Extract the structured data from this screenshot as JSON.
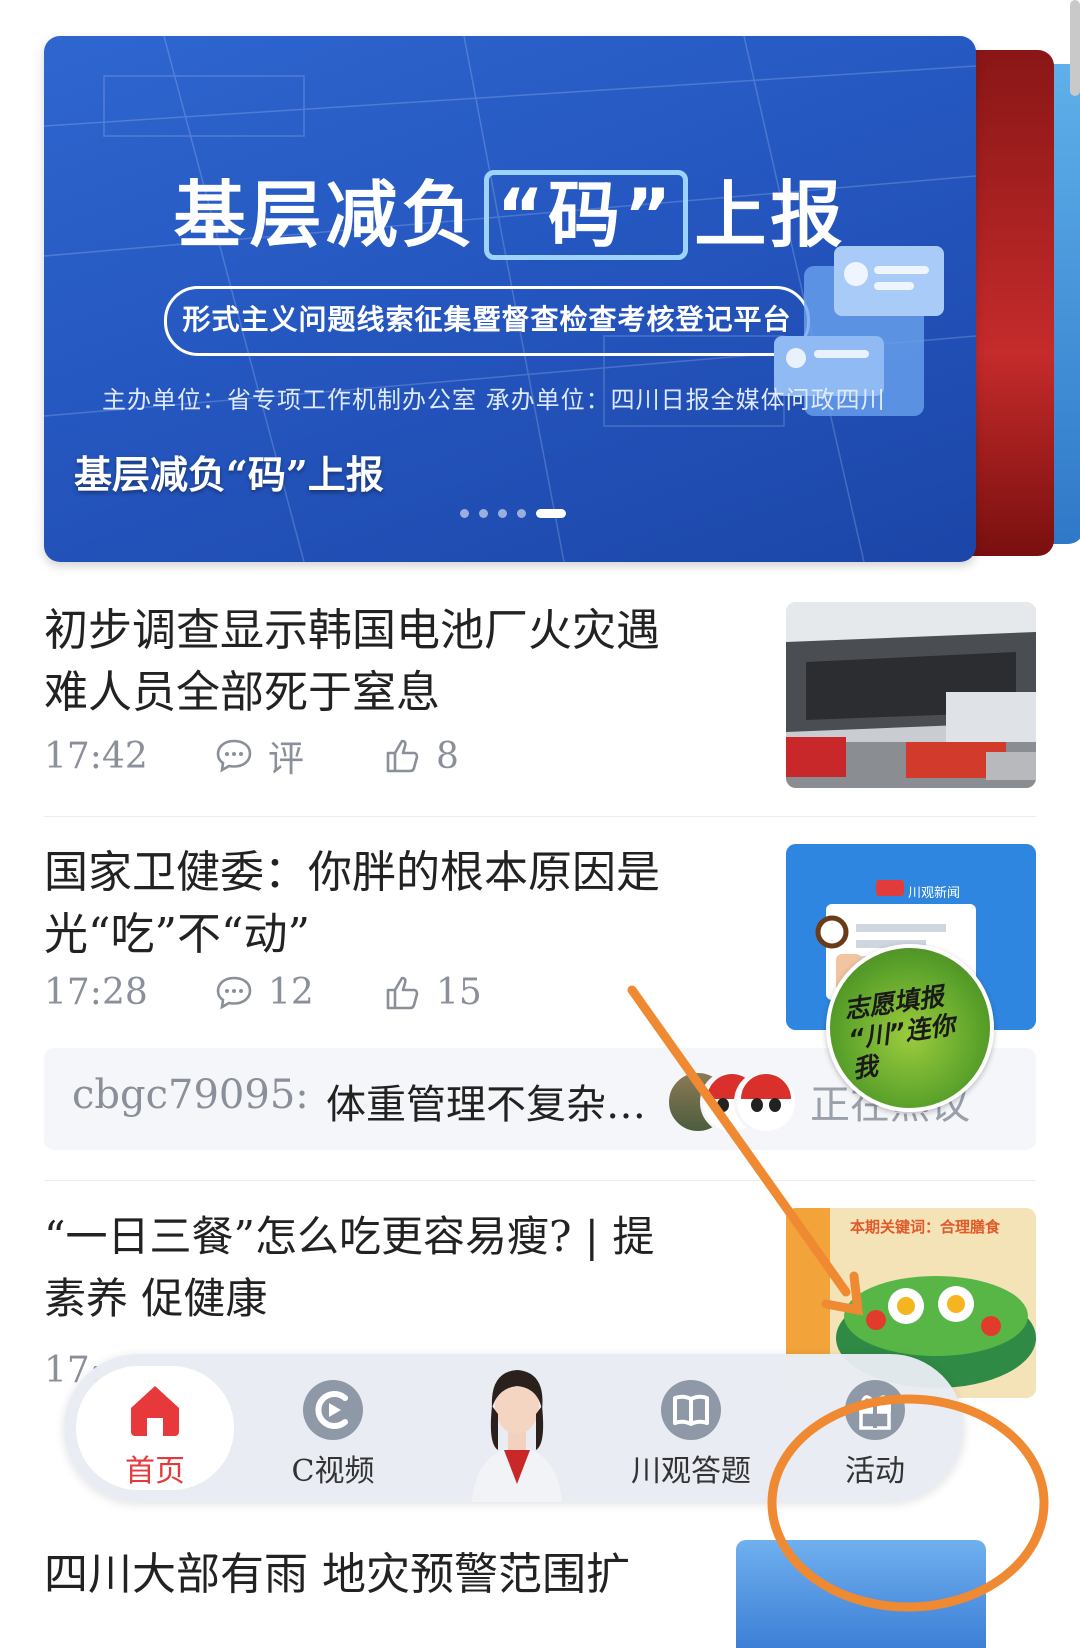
{
  "banner": {
    "title_pre": "基层减负",
    "title_key": "“码”",
    "title_post": "上报",
    "subtitle": "形式主义问题线索征集暨督查检查考核登记平台",
    "organizers": "主办单位：省专项工作机制办公室   承办单位：四川日报全媒体问政四川",
    "caption": "基层减负“码”上报",
    "dots_total": 5,
    "dots_active_index": 4
  },
  "news": [
    {
      "title": "初步调查显示韩国电池厂火灾遇难人员全部死于窒息",
      "time": "17:42",
      "comments": "评",
      "likes": "8"
    },
    {
      "title": "国家卫健委：你胖的根本原因是光“吃”不“动”",
      "time": "17:28",
      "comments": "12",
      "likes": "15",
      "thumb_label": "川观新闻"
    },
    {
      "title": "“一日三餐”怎么吃更容易瘦? | 提素养 促健康",
      "time": "17:",
      "thumb_label": "本期关键词：合理膳食"
    }
  ],
  "hot_comment": {
    "user": "cbgc79095:",
    "text": "体重管理不复杂…",
    "status": "正在热议"
  },
  "sticker": {
    "text": "志愿填报 “川”连你我"
  },
  "bottom_nav": {
    "items": [
      {
        "label": "首页",
        "icon": "home-icon",
        "active": true
      },
      {
        "label": "C视频",
        "icon": "video-icon"
      },
      {
        "label": "",
        "icon": "ai-assistant-avatar"
      },
      {
        "label": "川观答题",
        "icon": "book-icon"
      },
      {
        "label": "活动",
        "icon": "gift-icon"
      }
    ]
  },
  "next_item": {
    "title": "四川大部有雨  地灾预警范围扩"
  },
  "colors": {
    "accent_red": "#e7393b",
    "banner_blue": "#2557c0",
    "annotation_orange": "#f08a32",
    "meta_gray": "#8a8f99"
  }
}
